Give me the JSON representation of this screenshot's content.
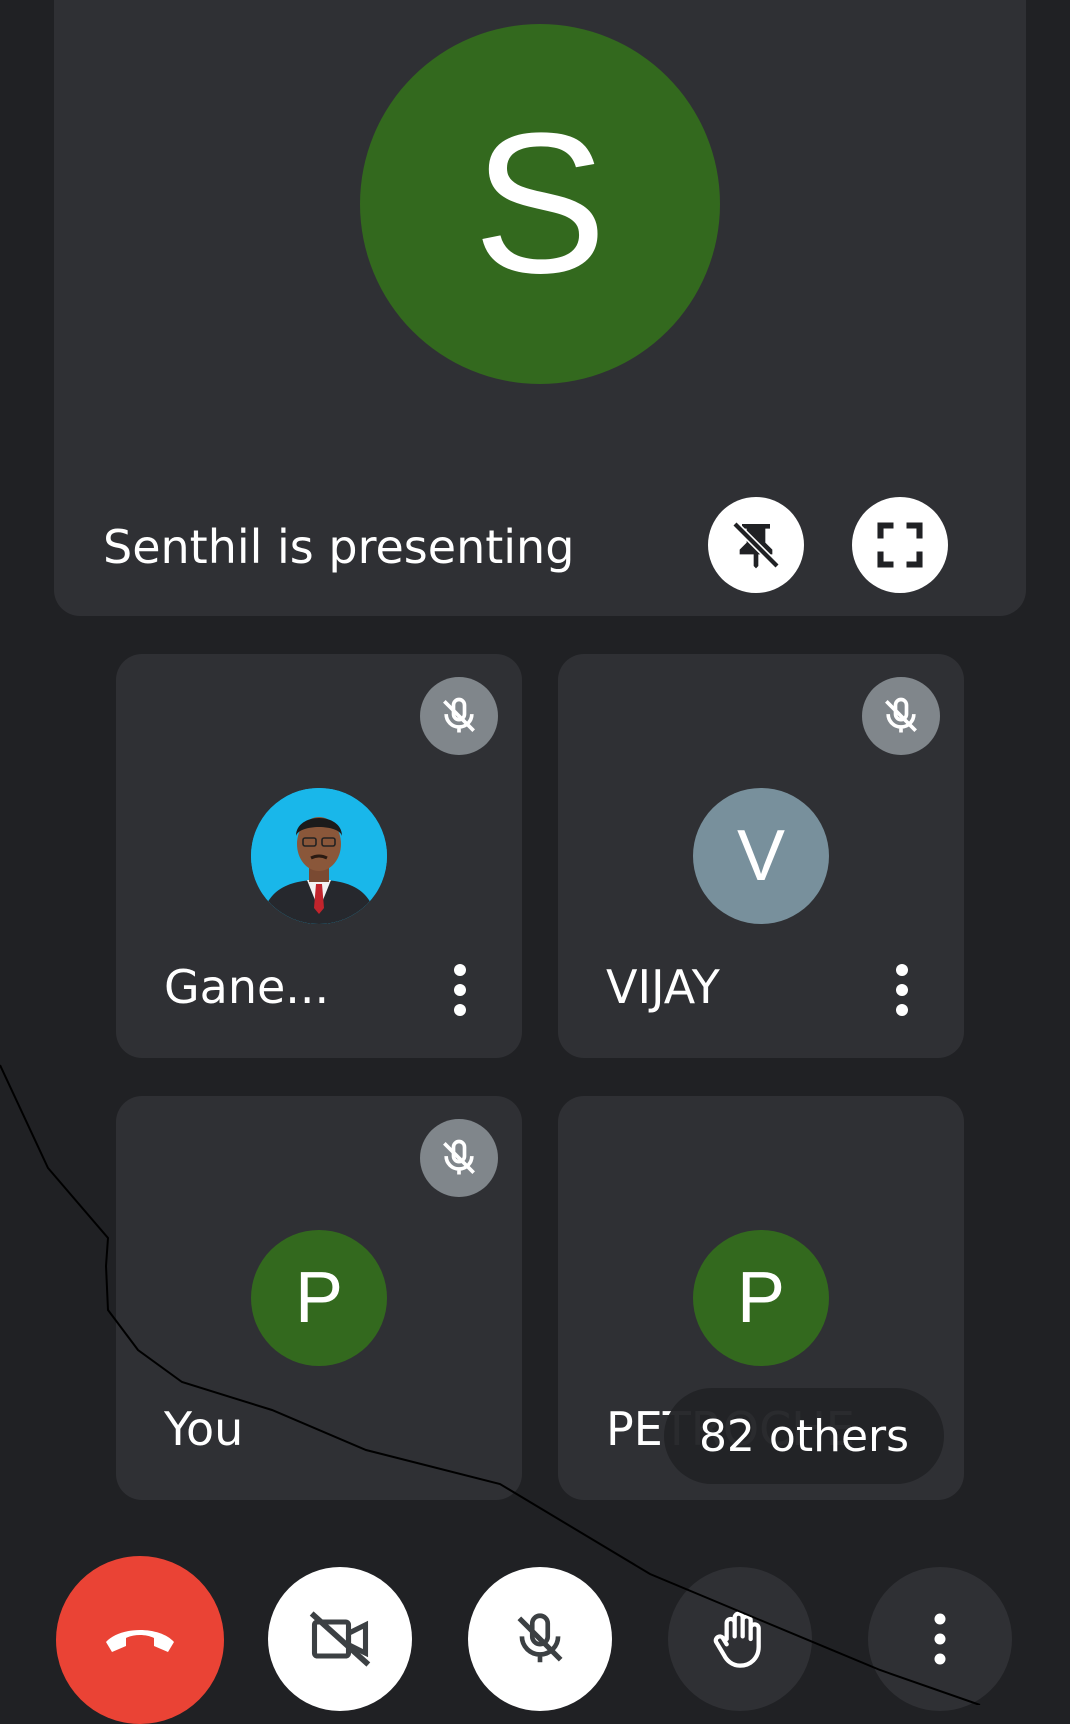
{
  "presenter": {
    "avatar_letter": "S",
    "avatar_color": "#33691e",
    "label": "Senthil is presenting",
    "unpin_icon": "unpin-icon",
    "fullscreen_icon": "fullscreen-icon"
  },
  "participants": [
    {
      "name": "Gane...",
      "avatar": "photo",
      "muted": true
    },
    {
      "name": "VIJAY",
      "avatar_letter": "V",
      "avatar_color": "#78909c",
      "muted": true
    },
    {
      "name": "You",
      "avatar_letter": "P",
      "avatar_color": "#33691e",
      "muted": true
    },
    {
      "name": "PETROCHE",
      "avatar_letter": "P",
      "avatar_color": "#33691e",
      "muted": false
    }
  ],
  "others_badge": "82 others",
  "controls": {
    "end_call_color": "#ea4335",
    "icons": [
      "end-call-icon",
      "camera-off-icon",
      "mic-off-icon",
      "raise-hand-icon",
      "more-options-icon"
    ]
  }
}
